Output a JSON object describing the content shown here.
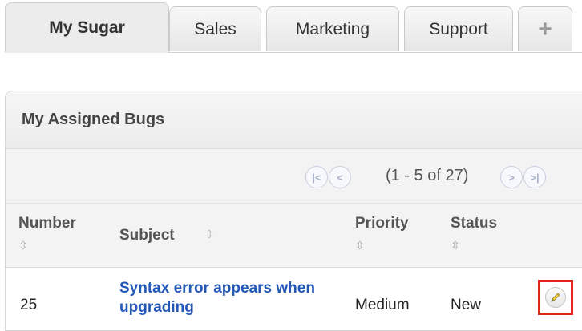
{
  "tabs": [
    {
      "label": "My Sugar",
      "active": true
    },
    {
      "label": "Sales"
    },
    {
      "label": "Marketing"
    },
    {
      "label": "Support"
    },
    {
      "label": "+"
    }
  ],
  "dashlet": {
    "title": "My Assigned Bugs",
    "pager": {
      "text": "(1 - 5 of 27)"
    },
    "columns": [
      "Number",
      "Subject",
      "Priority",
      "Status"
    ],
    "rows": [
      {
        "number": "25",
        "subject": "Syntax error appears when upgrading",
        "priority": "Medium",
        "status": "New"
      }
    ]
  },
  "icons": {
    "sort": "sort-icon",
    "edit": "pencil-icon",
    "pager_first": "first-page-icon",
    "pager_prev": "prev-page-icon",
    "pager_next": "next-page-icon",
    "pager_last": "last-page-icon"
  },
  "colors": {
    "link": "#2458b7",
    "highlight": "#e0241a"
  }
}
